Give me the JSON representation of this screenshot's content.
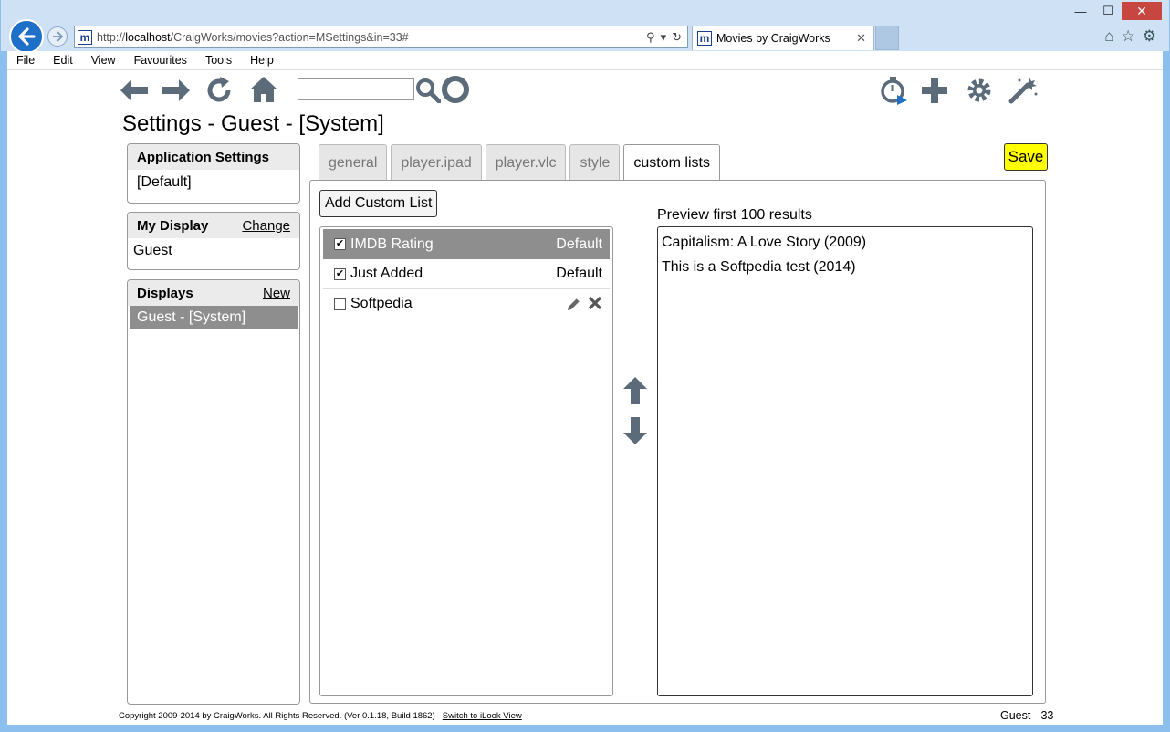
{
  "browser": {
    "url_prefix": "http://",
    "url_host": "localhost",
    "url_path": "/CraigWorks/movies?action=MSettings&in=33#",
    "tab_title": "Movies by CraigWorks",
    "favicon_letter": "m",
    "menu": [
      "File",
      "Edit",
      "View",
      "Favourites",
      "Tools",
      "Help"
    ]
  },
  "page": {
    "title": "Settings - Guest - [System]",
    "search_value": ""
  },
  "sidebar": {
    "app_settings": {
      "heading": "Application Settings",
      "value": "[Default]"
    },
    "my_display": {
      "heading": "My Display",
      "link": "Change",
      "value": "Guest"
    },
    "displays": {
      "heading": "Displays",
      "link": "New",
      "items": [
        "Guest - [System]"
      ]
    }
  },
  "tabs": [
    {
      "label": "general",
      "active": false
    },
    {
      "label": "player.ipad",
      "active": false
    },
    {
      "label": "player.vlc",
      "active": false
    },
    {
      "label": "style",
      "active": false
    },
    {
      "label": "custom lists",
      "active": true
    }
  ],
  "save_label": "Save",
  "custom_lists": {
    "add_label": "Add Custom List",
    "items": [
      {
        "label": "IMDB Rating",
        "checked": true,
        "tag": "Default",
        "selected": true
      },
      {
        "label": "Just Added",
        "checked": true,
        "tag": "Default",
        "selected": false
      },
      {
        "label": "Softpedia",
        "checked": false,
        "tag": "",
        "selected": false
      }
    ]
  },
  "preview": {
    "label": "Preview first 100 results",
    "items": [
      "Capitalism: A Love Story (2009)",
      "This is a Softpedia test (2014)"
    ]
  },
  "footer": {
    "copyright": "Copyright 2009-2014 by CraigWorks. All Rights Reserved. (Ver 0.1.18, Build 1862)",
    "link": "Switch to iLook View",
    "user": "Guest - 33"
  },
  "colors": {
    "save_bg": "#ffff00",
    "selected_row": "#8e8e8e",
    "icon_gray": "#5b6b79"
  }
}
